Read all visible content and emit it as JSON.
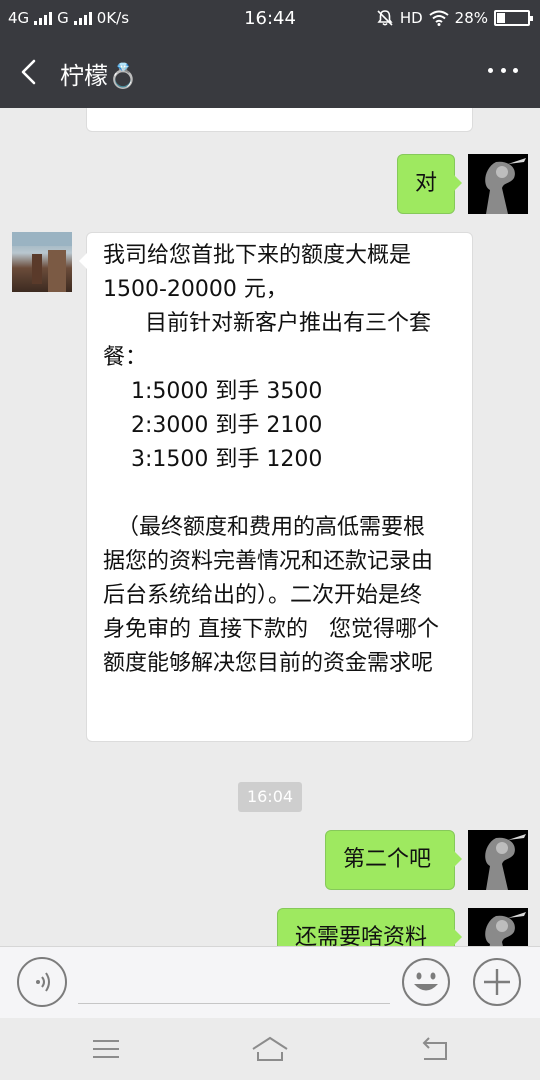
{
  "status_bar": {
    "network1": "4G",
    "network2": "G",
    "speed": "0K/s",
    "time": "16:44",
    "hd": "HD",
    "battery_percent": "28%",
    "battery_level": 0.28
  },
  "header": {
    "title": "柠檬💍"
  },
  "messages": [
    {
      "side": "right",
      "text": "对"
    },
    {
      "side": "left",
      "lines": [
        "我司给您首批下来的额度大概是",
        "1500-20000 元，",
        "      目前针对新客户推出有三个套",
        "餐：",
        "    1:5000 到手 3500",
        "    2:3000 到手 2100",
        "    3:1500 到手 1200",
        "",
        "  （最终额度和费用的高低需要根",
        "据您的资料完善情况和还款记录由",
        "后台系统给出的）。二次开始是终",
        "身免审的 直接下款的   您觉得哪个",
        "额度能够解决您目前的资金需求呢"
      ]
    },
    {
      "side": "right",
      "text": "第二个吧"
    },
    {
      "side": "right",
      "text": "还需要啥资料"
    }
  ],
  "time_divider": "16:04",
  "icons": {
    "back": "back-arrow-icon",
    "more": "more-dots-icon",
    "voice": "voice-icon",
    "emoji": "emoji-icon",
    "plus": "plus-icon",
    "nav_menu": "menu-icon",
    "nav_home": "home-icon",
    "nav_back": "back-icon"
  },
  "colors": {
    "title_bar": "#393a3f",
    "chat_bg": "#ebebeb",
    "bubble_green": "#9ee960",
    "bubble_white": "#ffffff"
  }
}
